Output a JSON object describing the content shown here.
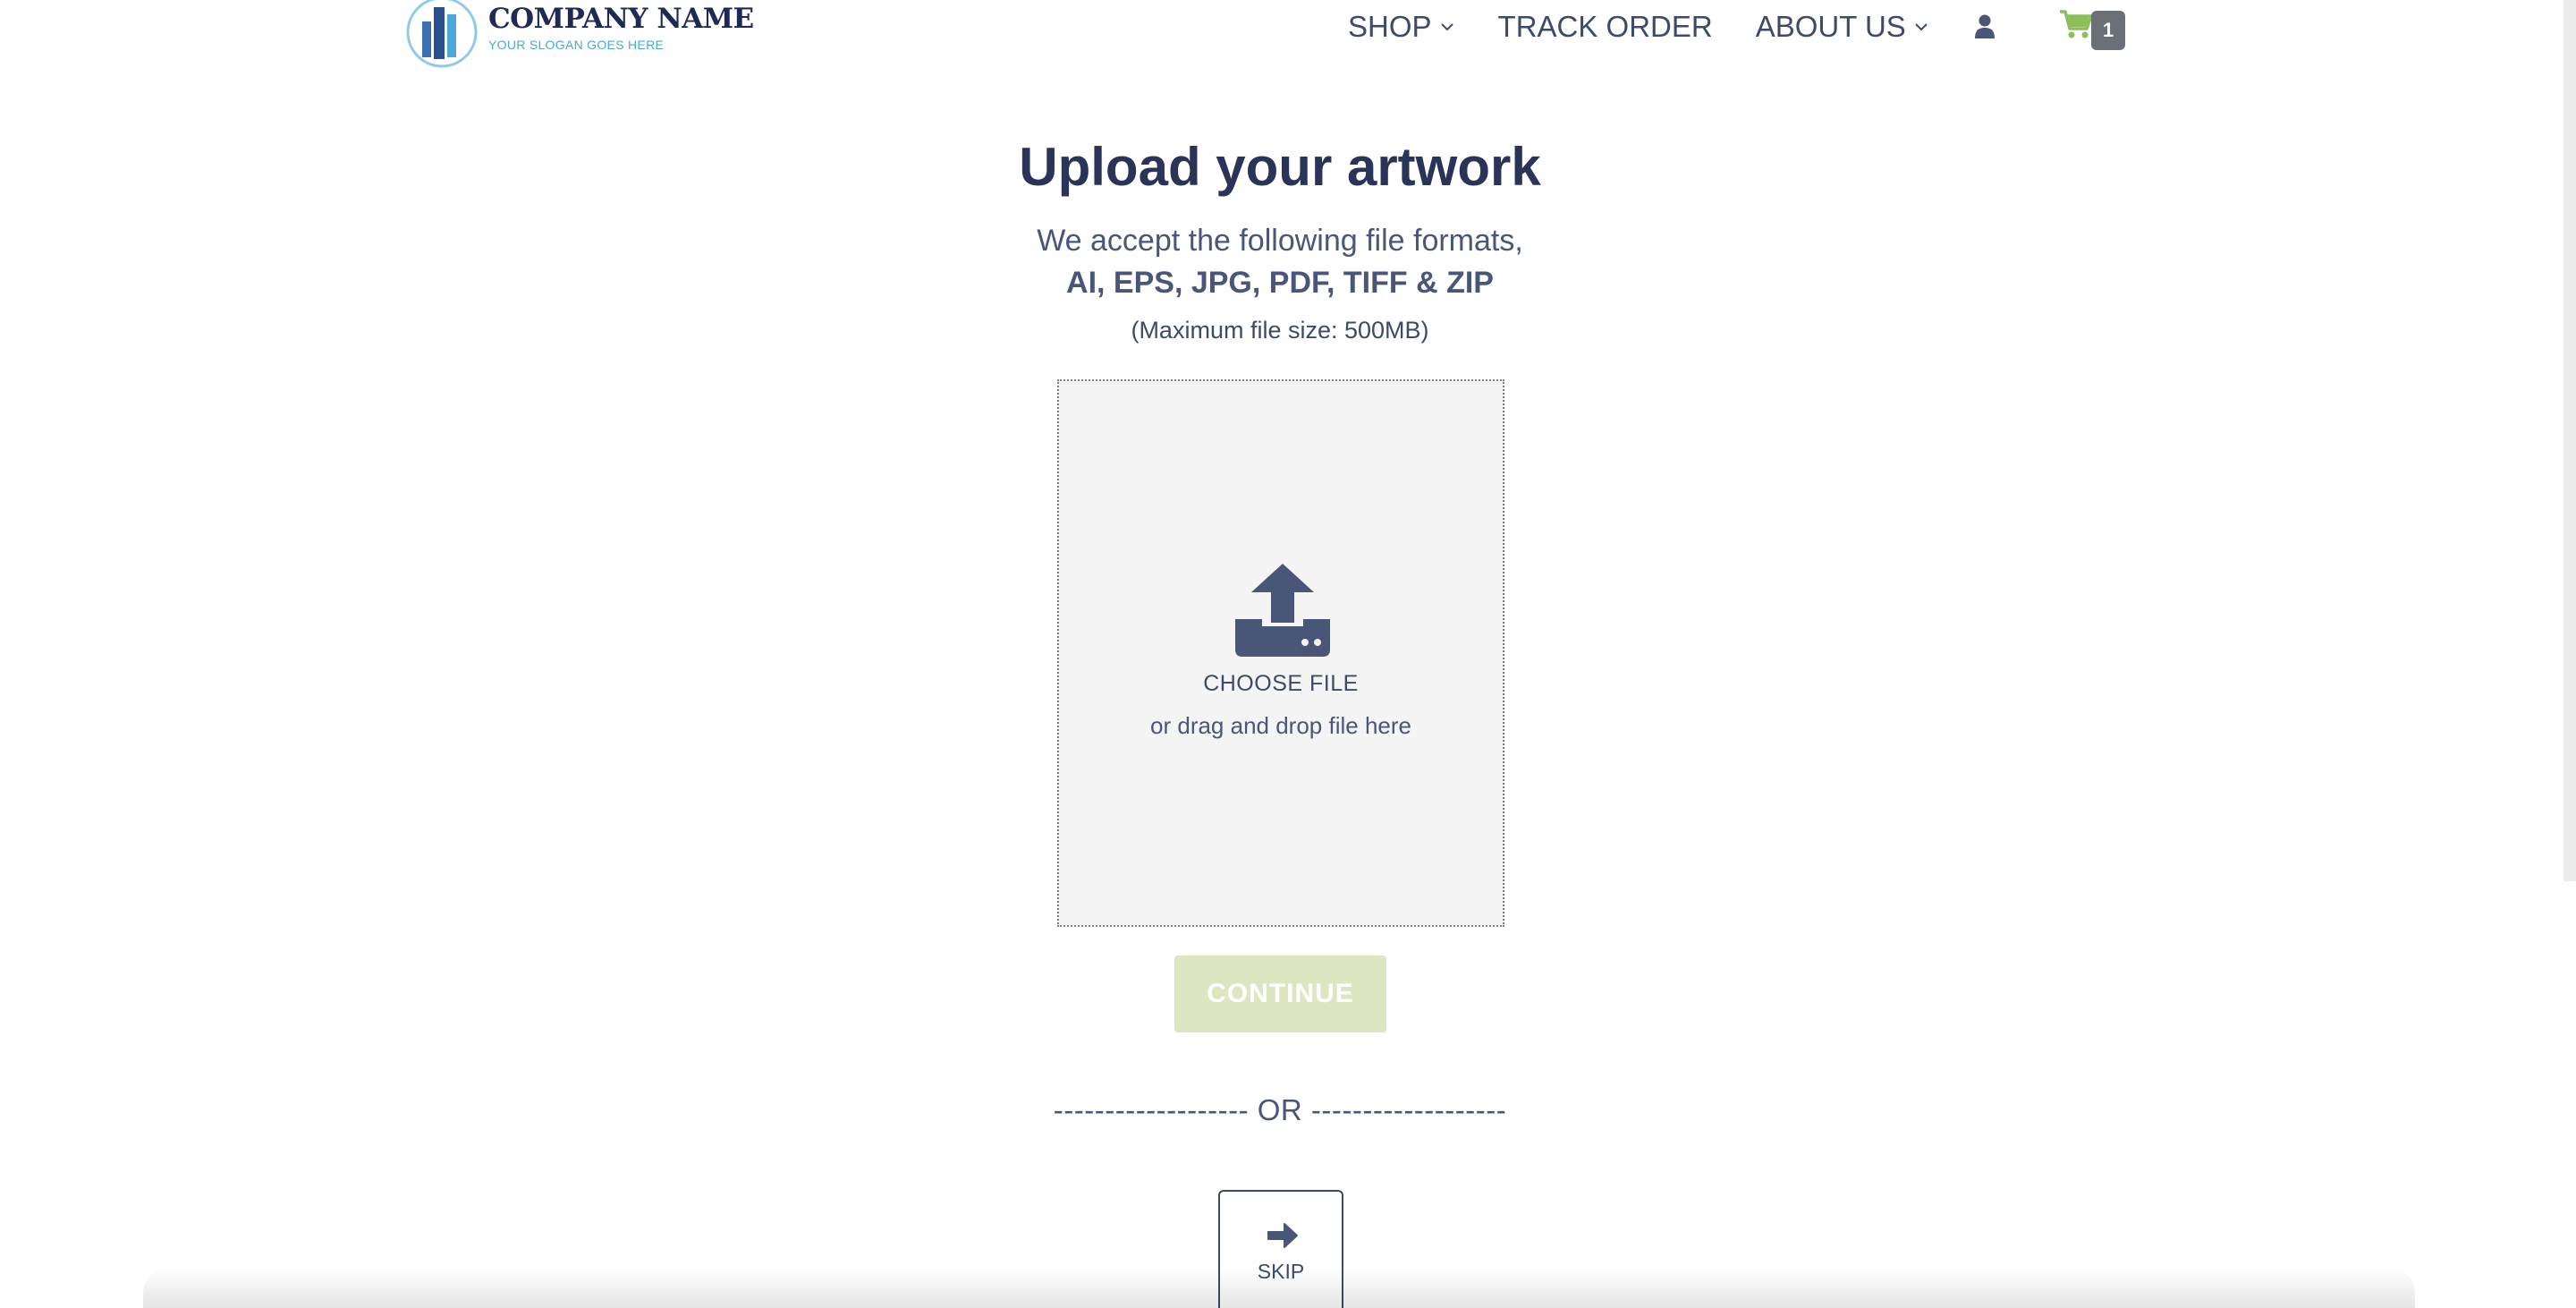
{
  "header": {
    "logo": {
      "name": "COMPANY NAME",
      "slogan": "YOUR SLOGAN GOES HERE"
    },
    "nav": {
      "shop": "SHOP",
      "track_order": "TRACK ORDER",
      "about_us": "ABOUT US"
    },
    "cart": {
      "count": "1"
    }
  },
  "upload": {
    "title": "Upload your artwork",
    "accept_text": "We accept the following file formats,",
    "formats": "AI, EPS, JPG, PDF, TIFF & ZIP",
    "max_size": "(Maximum file size: 500MB)",
    "choose_label": "CHOOSE FILE",
    "drag_label": "or drag and drop file here"
  },
  "actions": {
    "continue_label": "CONTINUE",
    "or_divider": "------------------- OR -------------------",
    "skip_label": "SKIP"
  },
  "colors": {
    "primary_text": "#4a5677",
    "title": "#2a3358",
    "cart_green": "#8cbf5a",
    "continue_disabled": "#dce7c1",
    "brand_blue": "#4aa8d8"
  },
  "icons": {
    "logo": "building-logo-icon",
    "chevron": "chevron-down-icon",
    "user": "user-icon",
    "cart": "shopping-cart-icon",
    "upload": "upload-icon",
    "skip": "arrow-right-icon"
  }
}
